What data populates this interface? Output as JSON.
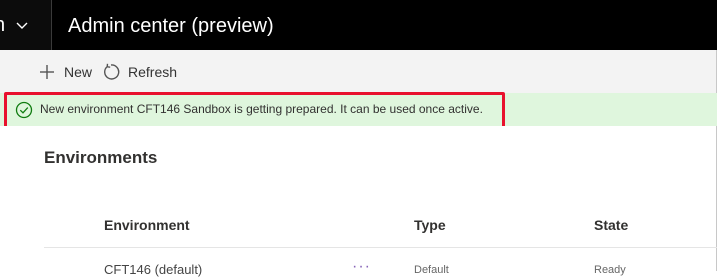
{
  "header": {
    "cut_letter": "n",
    "title": "Admin center (preview)"
  },
  "commandbar": {
    "new_label": "New",
    "refresh_label": "Refresh"
  },
  "notification": {
    "message": "New environment CFT146 Sandbox is getting prepared. It can be used once active.",
    "status_color": "#dff6dd",
    "icon": "checkmark-circle-icon"
  },
  "page": {
    "title": "Environments"
  },
  "table": {
    "columns": [
      "Environment",
      "Type",
      "State"
    ],
    "rows": [
      {
        "environment": "CFT146 (default)",
        "more": "···",
        "type": "Default",
        "state": "Ready"
      }
    ]
  },
  "colors": {
    "header_bg": "#000000",
    "accent_red": "#e8112d",
    "more_purple": "#8764b8"
  }
}
